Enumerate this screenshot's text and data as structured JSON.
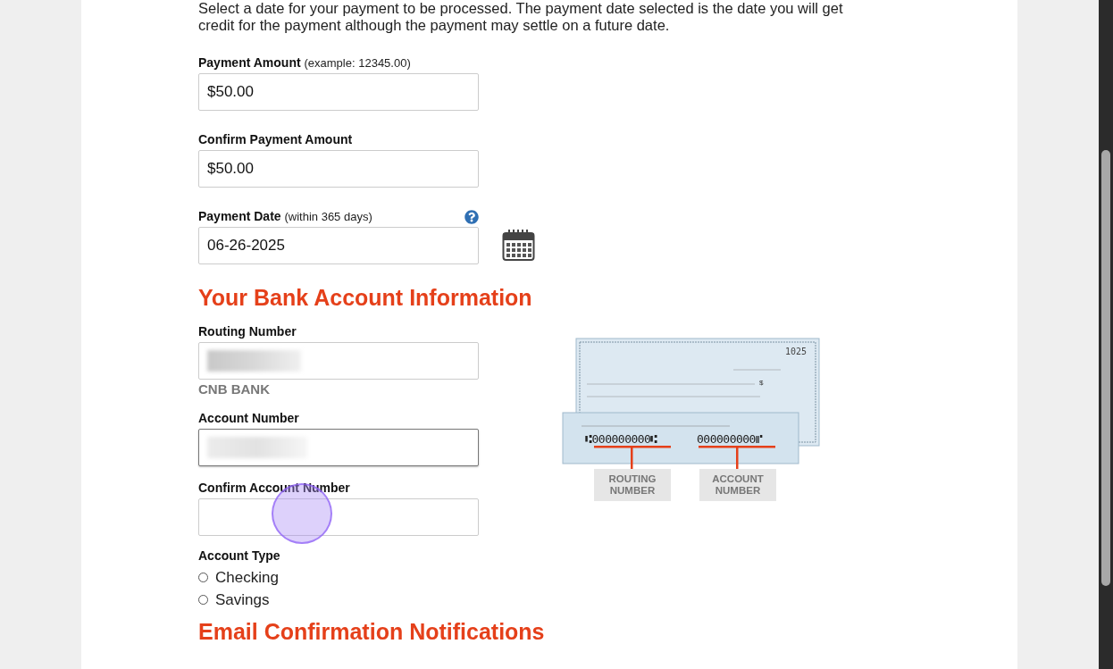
{
  "intro": "Select a date for your payment to be processed. The payment date selected is the date you will get credit for the payment although the payment may settle on a future date.",
  "payment_fields": [
    {
      "label": "Payment Amount",
      "hint": "(example: 12345.00)",
      "value": "$50.00",
      "help": false,
      "calendar": false
    },
    {
      "label": "Confirm Payment Amount",
      "value": "$50.00",
      "help": false,
      "calendar": false
    },
    {
      "label": "Payment Date",
      "hint": "(within 365 days)",
      "value": "06-26-2025",
      "help": true,
      "calendar": true
    }
  ],
  "bank_section": {
    "heading": "Your Bank Account Information",
    "fields": [
      {
        "label": "Routing Number",
        "redacted": true,
        "focused": false,
        "note": "CNB BANK"
      },
      {
        "label": "Account Number",
        "redacted": true,
        "focused": true
      },
      {
        "label": "Confirm Account Number",
        "redacted": false,
        "focused": false
      }
    ],
    "account_type": {
      "label": "Account Type",
      "options": [
        {
          "label": "Checking",
          "selected": false
        },
        {
          "label": "Savings",
          "selected": false
        }
      ]
    },
    "check_image": {
      "check_number": "1025",
      "currency": "$",
      "routing_digits": "⑆000000000⑆",
      "account_digits": "000000000⑈",
      "routing_label": "ROUTING NUMBER",
      "account_label": "ACCOUNT NUMBER"
    }
  },
  "email_section": {
    "heading": "Email Confirmation Notifications"
  }
}
